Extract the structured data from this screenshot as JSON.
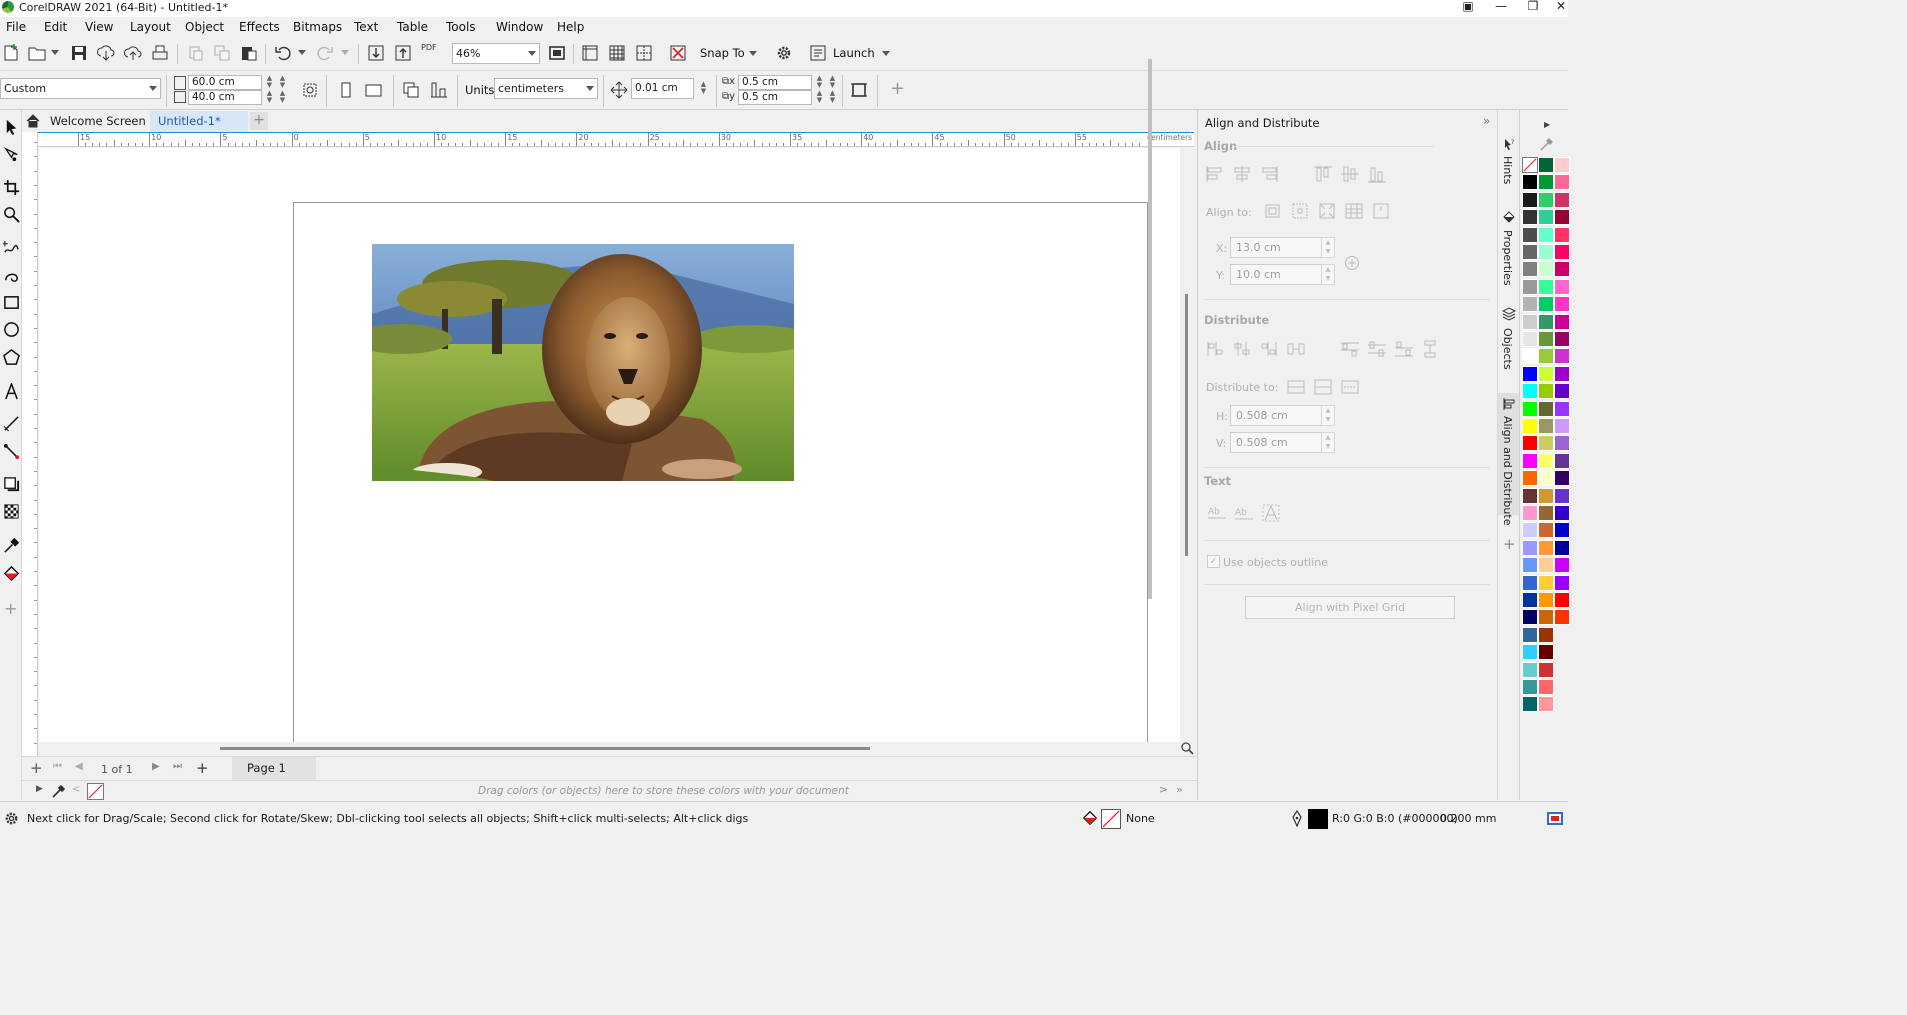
{
  "window": {
    "title": "CorelDRAW 2021 (64-Bit) - Untitled-1*"
  },
  "menu": [
    "File",
    "Edit",
    "View",
    "Layout",
    "Object",
    "Effects",
    "Bitmaps",
    "Text",
    "Table",
    "Tools",
    "Window",
    "Help"
  ],
  "toolbar": {
    "zoom": "46%",
    "snap_label": "Snap To",
    "launch_label": "Launch",
    "pdf_label": "PDF"
  },
  "propertybar": {
    "preset": "Custom",
    "width": "60.0 cm",
    "height": "40.0 cm",
    "units_label": "Units:",
    "units": "centimeters",
    "nudge": "0.01 cm",
    "dup_x": "0.5 cm",
    "dup_y": "0.5 cm"
  },
  "doc_tabs": {
    "welcome": "Welcome Screen",
    "current": "Untitled-1*"
  },
  "rulers": {
    "h_labels": [
      "15",
      "10",
      "5",
      "0",
      "5",
      "10",
      "15",
      "20",
      "25",
      "30",
      "35",
      "40",
      "45",
      "50",
      "55"
    ],
    "unit": "centimeters"
  },
  "page_nav": {
    "counter": "1 of 1",
    "page_tab": "Page 1"
  },
  "doc_palette_hint": "Drag colors (or objects) here to store these colors with your document",
  "status": {
    "hint": "Next click for Drag/Scale; Second click for Rotate/Skew; Dbl-clicking tool selects all objects; Shift+click multi-selects; Alt+click digs",
    "fill": "None",
    "outline_color": "R:0 G:0 B:0 (#000000)",
    "outline_width": "0.200 mm"
  },
  "docker": {
    "title": "Align and Distribute",
    "align_section": "Align",
    "align_to": "Align to:",
    "x_label": "X:",
    "x_value": "13.0 cm",
    "y_label": "Y:",
    "y_value": "10.0 cm",
    "distribute_section": "Distribute",
    "distribute_to": "Distribute to:",
    "h_label": "H:",
    "h_value": "0.508 cm",
    "v_label": "V:",
    "v_value": "0.508 cm",
    "text_section": "Text",
    "use_outline": "Use objects outline",
    "pixel_grid_button": "Align with Pixel Grid"
  },
  "docker_tabs": [
    "Hints",
    "Properties",
    "Objects",
    "Align and Distribute"
  ],
  "colors": {
    "accent": "#1b8fd8",
    "active_tab": "#d7e7f7"
  }
}
